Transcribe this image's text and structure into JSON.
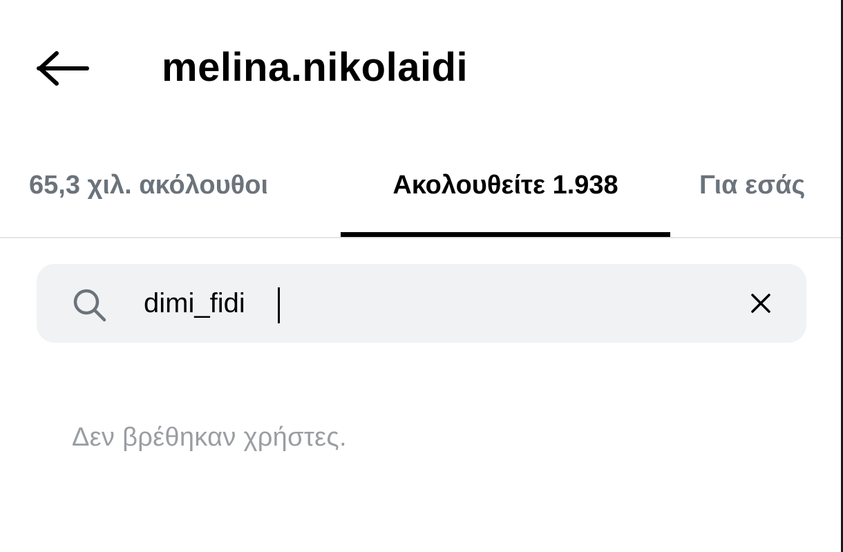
{
  "header": {
    "username": "melina.nikolaidi",
    "back_icon": "arrow-left-icon"
  },
  "tabs": [
    {
      "label": "65,3 χιλ. ακόλουθοι",
      "active": false
    },
    {
      "label": "Ακολουθείτε 1.938",
      "active": true
    },
    {
      "label": "Για εσάς",
      "active": false
    }
  ],
  "search": {
    "icon": "search-icon",
    "value": "dimi_fidi",
    "clear_icon": "close-icon"
  },
  "results": {
    "empty_message": "Δεν βρέθηκαν χρήστες."
  },
  "colors": {
    "active_text": "#000000",
    "inactive_tab_text": "#6b737b",
    "search_background": "#f0f2f4",
    "empty_text": "#9a9ea3"
  }
}
